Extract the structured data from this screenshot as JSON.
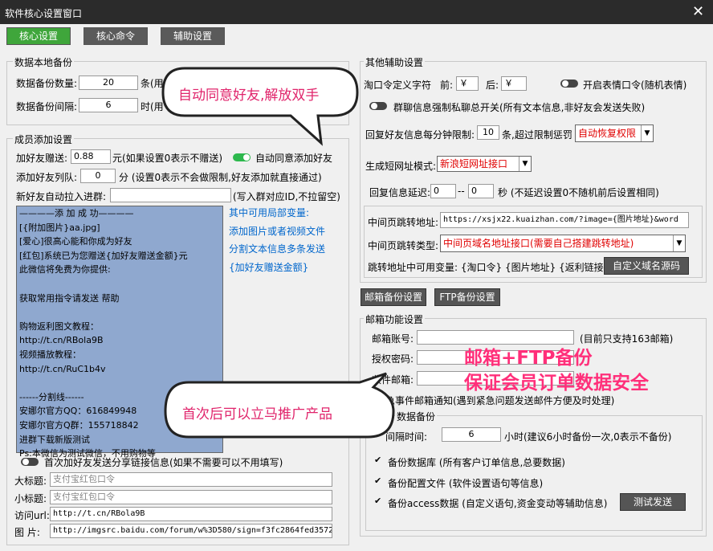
{
  "window": {
    "title": "软件核心设置窗口",
    "close": "✕"
  },
  "tabs": [
    {
      "label": "核心设置",
      "active": true
    },
    {
      "label": "核心命令",
      "active": false
    },
    {
      "label": "辅助设置",
      "active": false
    }
  ],
  "colors": {
    "active_tab": "#3fa63b",
    "inactive_tab": "#5a5a5a",
    "bubble_text": "#e0246b",
    "overlay_text": "#ff2f7a",
    "toggle_on": "#2db84d"
  },
  "backup": {
    "legend": "数据本地备份",
    "count_label": "数据备份数量:",
    "count_value": "20",
    "count_unit": "条(用",
    "interval_label": "数据备份间隔:",
    "interval_value": "6",
    "interval_unit": "时(用"
  },
  "member": {
    "legend": "成员添加设置",
    "gift_label": "加好友赠送:",
    "gift_value": "0.88",
    "gift_note": "元(如果设置0表示不赠送)",
    "auto_accept_label": "自动同意添加好友",
    "queue_label": "添加好友列队:",
    "queue_value": "0",
    "queue_note": "分 (设置0表示不会做限制,好友添加就直接通过)",
    "group_label": "新好友自动拉入进群:",
    "group_value": "",
    "group_note": "(写入群对应ID,不拉留空)",
    "message_lines": [
      "————添 加 成 功————",
      "[{附加图片}aa.jpg]",
      "[爱心]很高心能和你成为好友",
      "[红包]系统已为您赠送{加好友赠送金额}元",
      "此微信将免费为你提供:",
      "",
      "获取常用指令请发送  帮助",
      "",
      "购物返利图文教程：",
      "http://t.cn/RBola9B",
      "视频播放教程：",
      "http://t.cn/RuC1b4v",
      "",
      "------分割线------",
      "安娜尔官方QQ：616849948",
      "安娜尔官方Q群：155718842",
      "进群下载新版测试",
      "Ps:本微信为测试微信，不用购物等"
    ],
    "vars_title": "其中可用局部变量:",
    "vars": [
      "添加图片或者视频文件",
      "分割文本信息多条发送",
      "{加好友赠送金额}"
    ],
    "share_toggle_label": "首次加好友发送分享链接信息(如果不需要可以不用填写)",
    "title_label": "大标题:",
    "title_value": "支付宝红包口令",
    "subtitle_label": "小标题:",
    "subtitle_value": "支付宝红包口令",
    "url_label": "访问url:",
    "url_value": "http://t.cn/RBola9B",
    "image_label": "图    片:",
    "image_value": "http://imgsrc.baidu.com/forum/w%3D580/sign=f3fc2864fed3572"
  },
  "other": {
    "legend": "其他辅助设置",
    "cmd_label": "淘口令定义字符",
    "before_label": "前:",
    "before_value": "￥",
    "after_label": "后:",
    "after_value": "￥",
    "emoji_label": "开启表情口令(随机表情)",
    "group_private_label": "群聊信息强制私聊总开关(所有文本信息,非好友会发送失败)",
    "reply_limit_label": "回复好友信息每分钟限制:",
    "reply_limit_value": "10",
    "reply_limit_note": "条,超过限制惩罚",
    "penalty_value": "自动恢复权限",
    "shortlink_label": "生成短网址模式:",
    "shortlink_value": "新浪短网址接口",
    "delay_label": "回复信息延迟:",
    "delay_from": "0",
    "delay_sep": "--",
    "delay_to": "0",
    "delay_note": "秒 (不延迟设置0不随机前后设置相同)",
    "jump_label": "中间页跳转地址:",
    "jump_value": "https://xsjx22.kuaizhan.com/?image={图片地址}&word",
    "jump_type_label": "中间页跳转类型:",
    "jump_type_value": "中间页域名地址接口(需要自己搭建跳转地址)",
    "jump_vars": "跳转地址中可用变量: {淘口令} {图片地址} {返利链接}",
    "custom_domain_btn": "自定义域名源码"
  },
  "backup_tabs": [
    "邮箱备份设置",
    "FTP备份设置"
  ],
  "mail": {
    "legend": "邮箱功能设置",
    "account_label": "邮箱账号:",
    "account_value": "",
    "account_note": "(目前只支持163邮箱)",
    "auth_label": "授权密码:",
    "auth_value": "",
    "recv_label": "收件邮箱:",
    "recv_value": "",
    "urgent_label": "急事件邮箱通知(遇到紧急问题发送邮件方便及时处理)",
    "data_legend": "数据备份",
    "interval_label": "间隔时间:",
    "interval_value": "6",
    "interval_note": "小时(建议6小时备份一次,0表示不备份)",
    "opt1": "备份数据库  (所有客户订单信息,总要数据)",
    "opt2": "备份配置文件  (软件设置语句等信息)",
    "opt3": "备份access数据  (自定义语句,资金变动等辅助信息)",
    "test_btn": "测试发送"
  },
  "callouts": {
    "top": "自动同意好友,解放双手",
    "bottom": "首次后可以立马推广产品",
    "right_line1": "邮箱+FTP备份",
    "right_line2": "保证会员订单数据安全"
  }
}
